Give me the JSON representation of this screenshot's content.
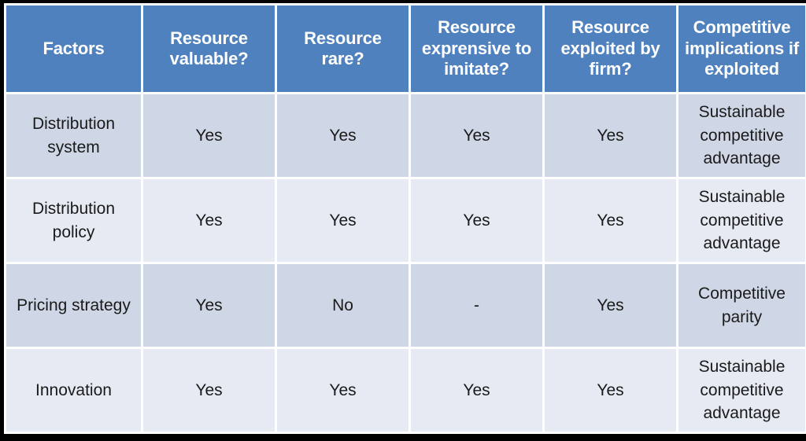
{
  "table": {
    "columns": [
      {
        "key": "factor",
        "label": "Factors"
      },
      {
        "key": "valuable",
        "label": "Resource valuable?"
      },
      {
        "key": "rare",
        "label": "Resource rare?"
      },
      {
        "key": "imitate",
        "label": "Resource exprensive to imitate?"
      },
      {
        "key": "exploit",
        "label": "Resource exploited by firm?"
      },
      {
        "key": "implic",
        "label": "Competitive implications if exploited"
      }
    ],
    "rows": [
      {
        "factor": "Distribution system",
        "valuable": "Yes",
        "rare": "Yes",
        "imitate": "Yes",
        "exploit": "Yes",
        "implic": "Sustainable competitive advantage"
      },
      {
        "factor": "Distribution policy",
        "valuable": "Yes",
        "rare": "Yes",
        "imitate": "Yes",
        "exploit": "Yes",
        "implic": "Sustainable competitive advantage"
      },
      {
        "factor": "Pricing strategy",
        "valuable": "Yes",
        "rare": "No",
        "imitate": "-",
        "exploit": "Yes",
        "implic": "Competitive parity"
      },
      {
        "factor": "Innovation",
        "valuable": "Yes",
        "rare": "Yes",
        "imitate": "Yes",
        "exploit": "Yes",
        "implic": "Sustainable competitive advantage"
      }
    ]
  },
  "colors": {
    "header_background": "#4E81BE",
    "header_text": "#FFFFFF",
    "row_dark": "#CFD6E5",
    "row_light": "#E6EAF2",
    "cell_text": "#1A1A1A",
    "frame": "#000000",
    "gutter": "#FFFFFF"
  }
}
